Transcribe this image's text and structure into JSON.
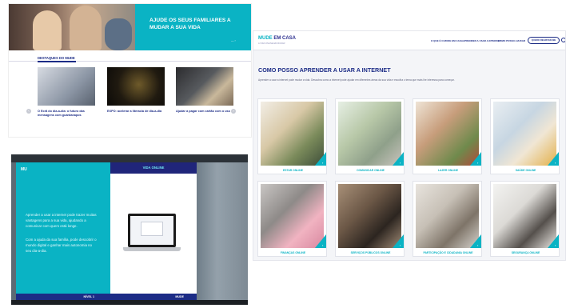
{
  "panel_a": {
    "hero": {
      "title": "AJUDE OS SEUS FAMILIARES A MUDAR A SUA VIDA",
      "link": "— ›"
    },
    "news": {
      "title": "DESTAQUES DO MUDE",
      "cards": [
        {
          "tag": "",
          "title": "O Ecrã do dia-a-dia: o futuro das mensagens com guardanapos",
          "desc": "",
          "image_icon": "laptop-photo"
        },
        {
          "tag": "",
          "title": "EXPO: acelerar a literacia de dia-a-dia",
          "desc": "",
          "image_icon": "oscars-photo"
        },
        {
          "tag": "",
          "title": "Ajudar a pagar com cartão com o uso",
          "desc": "",
          "image_icon": "payment-photo"
        }
      ],
      "prev_glyph": "‹",
      "next_glyph": "›"
    }
  },
  "panel_b": {
    "logo": "MU",
    "left_paragraphs": [
      "Aprender a usar a internet pode trazer muitas vantagens para a sua vida, ajudando a comunicar com quem está longe.",
      "Com a ajuda da sua família, pode descobrir o mundo digital e ganhar mais autonomia no seu dia-a-dia."
    ],
    "left_footer": "NÍVEL 1",
    "right_header": "VIDA ONLINE",
    "right_footer": "MUDE"
  },
  "panel_c": {
    "logo": {
      "prefix": "MUDE",
      "suffix": " EM CASA",
      "sub": "A VIDA ONLINE EM MUDAR"
    },
    "nav": [
      "O QUE É O MUDE EM CASA",
      "APRENDER A USAR A INTERNET",
      "COMO POSSO AJUDAR"
    ],
    "nav_button": "QUERO REGISTAR-ME",
    "heading": "COMO POSSO APRENDER A USAR A INTERNET",
    "subtitle": "Aprender a usar a internet pode mudar a vida. Descubra como a internet pode ajudar em diferentes áreas da sua vida e escolha o tema que mais lhe interessa para começar.",
    "tiles": [
      {
        "label": "ESTAR ONLINE",
        "icon": "computer-couple-photo"
      },
      {
        "label": "COMUNICAR ONLINE",
        "icon": "tablet-elderly-photo"
      },
      {
        "label": "LAZER ONLINE",
        "icon": "shopping-tablet-photo"
      },
      {
        "label": "SAÚDE ONLINE",
        "icon": "doctor-patient-photo"
      },
      {
        "label": "FINANÇAS ONLINE",
        "icon": "piggy-bank-photo"
      },
      {
        "label": "SERVIÇOS PÚBLICOS ONLINE",
        "icon": "woman-tablet-photo"
      },
      {
        "label": "PARTICIPAÇÃO E CIDADANIA ONLINE",
        "icon": "couple-laptop-photo"
      },
      {
        "label": "SEGURANÇA ONLINE",
        "icon": "worried-woman-photo"
      }
    ],
    "corner_glyph": "›"
  },
  "colors": {
    "teal": "#0ab3c4",
    "navy": "#1c2c86"
  }
}
